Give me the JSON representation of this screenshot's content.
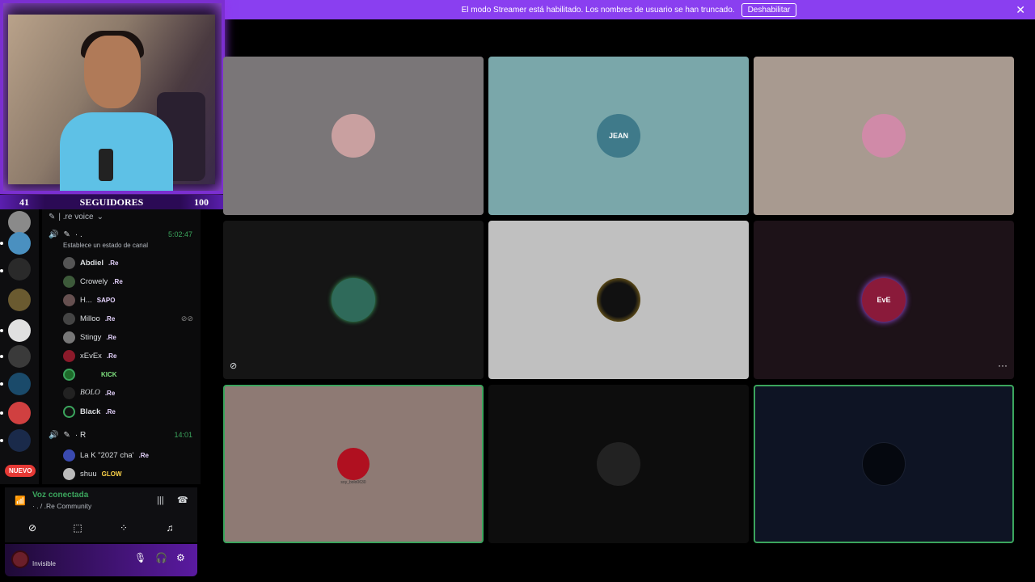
{
  "banner": {
    "text": "El modo Streamer está habilitado. Los nombres de usuario se han truncado.",
    "button_label": "Deshabilitar",
    "close_glyph": "✕"
  },
  "overlay": {
    "followers_current": "41",
    "followers_label": "SEGUIDORES",
    "followers_goal": "100"
  },
  "servers": {
    "new_badge": "NUEVO"
  },
  "channels": {
    "header": "| .re voice",
    "voice_channel_1": {
      "name": "· .",
      "time": "5:02:47",
      "status": "Establece un estado de canal"
    },
    "members_1": [
      {
        "name": "Abdiel",
        "tag": ".Re",
        "color": "#555"
      },
      {
        "name": "Crowely",
        "tag": ".Re",
        "color": "#3d5a3a"
      },
      {
        "name": "H...",
        "tag": "SAPO",
        "color": "#665050"
      },
      {
        "name": "Milloo",
        "tag": ".Re",
        "color": "#444"
      },
      {
        "name": "Stingy",
        "tag": ".Re",
        "color": "#777"
      },
      {
        "name": "xEvEx",
        "tag": ".Re",
        "color": "#8b1a2a"
      },
      {
        "name": "",
        "tag": "KICK",
        "color": "#1e6b2a"
      },
      {
        "name": "BOLO",
        "tag": ".Re",
        "color": "#222"
      },
      {
        "name": "Black",
        "tag": ".Re",
        "color": "#111"
      }
    ],
    "voice_channel_2": {
      "name": "· R",
      "time": "14:01"
    },
    "members_2": [
      {
        "name": "La K \"2027 cha'",
        "tag": ".Re",
        "color": "#3a4ab0"
      },
      {
        "name": "shuu",
        "tag": "GLOW",
        "color": "#bbb"
      }
    ]
  },
  "voice_panel": {
    "title": "Voz conectada",
    "subtitle": "· . / .Re Community"
  },
  "user_panel": {
    "status": "Invisible"
  },
  "tiles": [
    {
      "bg": "#7a7678",
      "avatar_color": "#c9a0a0",
      "speaking": false
    },
    {
      "bg": "#7aa7aa",
      "avatar_color": "#3f7a8a",
      "label": "JEAN",
      "speaking": false
    },
    {
      "bg": "#a89a90",
      "avatar_color": "#d08aa8",
      "speaking": false
    },
    {
      "bg": "#151515",
      "avatar_color": "#2f6a5a",
      "speaking": false
    },
    {
      "bg": "#c0c0c0",
      "avatar_color": "#1a1a1a",
      "speaking": false
    },
    {
      "bg": "#1d1218",
      "avatar_color": "#8a1a3a",
      "label": "EvE",
      "speaking": false
    },
    {
      "bg": "#8e7a74",
      "avatar_color": "#b01020",
      "caption": "soy_bolo0630",
      "speaking": true
    },
    {
      "bg": "#0d0d0d",
      "avatar_color": "#222222",
      "speaking": false
    },
    {
      "bg": "#0e1424",
      "avatar_color": "#05080f",
      "speaking": true
    }
  ]
}
